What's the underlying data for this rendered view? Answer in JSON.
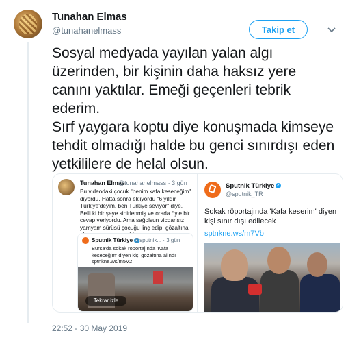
{
  "tweet": {
    "author_name": "Tunahan Elmas",
    "author_handle": "@tunahanelmass",
    "follow_label": "Takip et",
    "text_p1": "Sosyal medyada yayılan yalan algı üzerinden, bir kişinin daha haksız yere canını yaktılar. Emeği geçenleri tebrik ederim.",
    "text_p2": "Sırf yaygara koptu diye konuşmada kimseye tehdit olmadığı halde bu genci sınırdışı eden yetkililere de helal olsun.",
    "timestamp": "22:52 - 30 May 2019"
  },
  "quoted": {
    "author_name": "Tunahan Elmas",
    "author_handle": "@tunahanelmass · 3 gün",
    "text": "Bu videodaki çocuk \"benim kafa keseceğim\" diyordu. Hatta sonra ekliyordu \"6 yıldır Türkiye'deyim, ben Türkiye seviyor\" diye. Belli ki bir şeye sinirlenmiş ve orada öyle bir cevap veriyordu. Ama sağolsun vicdansız yamyam sürüsü çocuğu linç edip, gözaltına alınmasına sebep oldu.",
    "inner": {
      "author_name": "Sputnik Türkiye",
      "author_handle": "@sputnik... · 3 gün",
      "text": "Bursa'da sokak röportajında 'Kafa keseceğim' diyen kişi gözaltına alındı sptnkne.ws/m5V2",
      "video_label": "Tekrar izle"
    }
  },
  "retweet_card": {
    "author_name": "Sputnik Türkiye",
    "author_handle": "@sputnik_TR",
    "text": "Sokak röportajında 'Kafa keserim' diyen kişi sınır dışı edilecek",
    "link": "sptnkne.ws/m7Vb"
  },
  "colors": {
    "accent": "#1da1f2",
    "sputnik": "#ef6c1b",
    "muted": "#657786"
  }
}
